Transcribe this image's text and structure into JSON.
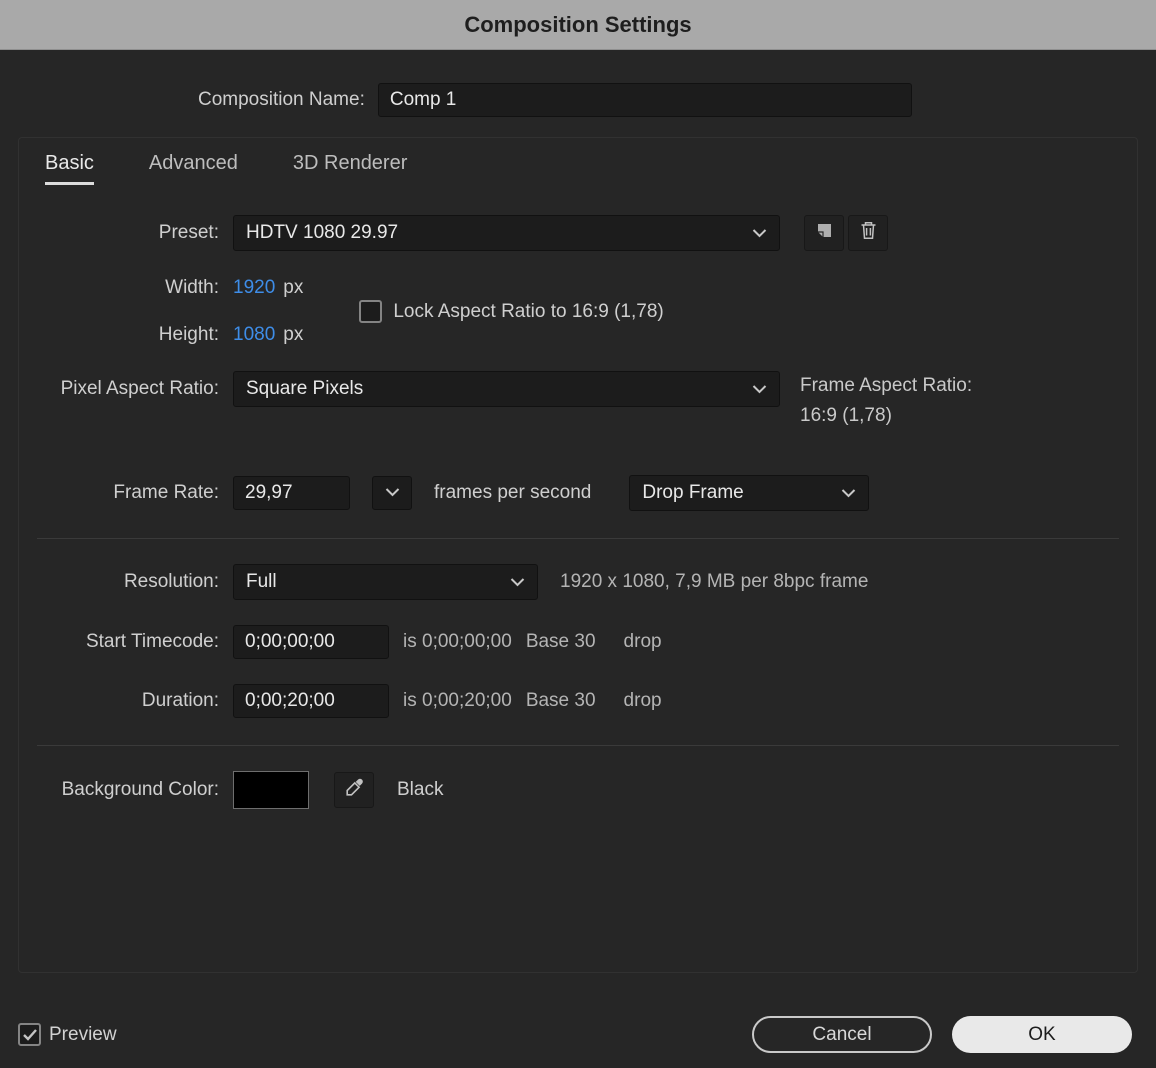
{
  "window": {
    "title": "Composition Settings"
  },
  "name_field": {
    "label": "Composition Name:",
    "value": "Comp 1"
  },
  "tabs": {
    "basic": "Basic",
    "advanced": "Advanced",
    "renderer": "3D Renderer"
  },
  "basic": {
    "preset": {
      "label": "Preset:",
      "value": "HDTV 1080 29.97"
    },
    "width": {
      "label": "Width:",
      "value": "1920",
      "unit": "px"
    },
    "height": {
      "label": "Height:",
      "value": "1080",
      "unit": "px"
    },
    "lock_aspect": {
      "label": "Lock Aspect Ratio to 16:9 (1,78)",
      "checked": false
    },
    "pixel_aspect": {
      "label": "Pixel Aspect Ratio:",
      "value": "Square Pixels"
    },
    "frame_aspect": {
      "label": "Frame Aspect Ratio:",
      "value": "16:9 (1,78)"
    },
    "frame_rate": {
      "label": "Frame Rate:",
      "value": "29,97",
      "suffix": "frames per second",
      "dropdown": "Drop Frame"
    },
    "resolution": {
      "label": "Resolution:",
      "value": "Full",
      "info": "1920 x 1080, 7,9 MB per 8bpc frame"
    },
    "start_timecode": {
      "label": "Start Timecode:",
      "value": "0;00;00;00",
      "equiv": "is 0;00;00;00",
      "base": "Base 30",
      "drop": "drop"
    },
    "duration": {
      "label": "Duration:",
      "value": "0;00;20;00",
      "equiv": "is 0;00;20;00",
      "base": "Base 30",
      "drop": "drop"
    },
    "background": {
      "label": "Background Color:",
      "color_name": "Black",
      "hex": "#000000"
    }
  },
  "footer": {
    "preview": {
      "label": "Preview",
      "checked": true
    },
    "cancel": "Cancel",
    "ok": "OK"
  },
  "colors": {
    "value_accent": "#3e8de8",
    "titlebar": "#a9a9a9"
  }
}
